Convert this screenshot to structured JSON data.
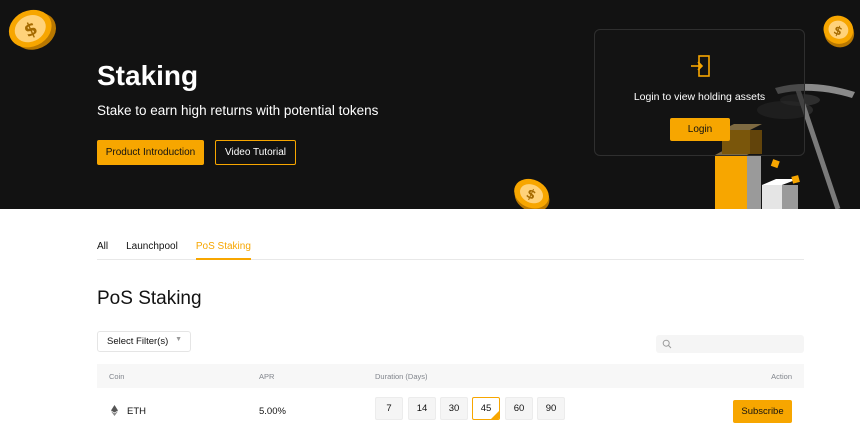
{
  "hero": {
    "title": "Staking",
    "subtitle": "Stake to earn high returns with potential tokens",
    "product_intro_label": "Product Introduction",
    "video_tutorial_label": "Video Tutorial",
    "login_prompt": "Login to view holding assets",
    "login_label": "Login"
  },
  "tabs": [
    {
      "label": "All",
      "active": false
    },
    {
      "label": "Launchpool",
      "active": false
    },
    {
      "label": "PoS Staking",
      "active": true
    }
  ],
  "section_title": "PoS Staking",
  "filter": {
    "label": "Select Filter(s)"
  },
  "search": {
    "placeholder": "",
    "icon": "search-icon"
  },
  "table": {
    "headers": {
      "coin": "Coin",
      "apr": "APR",
      "duration": "Duration (Days)",
      "action": "Action"
    },
    "rows": [
      {
        "coin": "ETH",
        "coin_icon": "eth-icon",
        "apr": "5.00%",
        "durations": [
          "7",
          "14",
          "30",
          "45",
          "60",
          "90"
        ],
        "selected_duration": "45",
        "action_label": "Subscribe"
      }
    ]
  },
  "colors": {
    "accent": "#f7a600",
    "hero_bg": "#121212",
    "text": "#121212",
    "muted": "#81858c"
  }
}
